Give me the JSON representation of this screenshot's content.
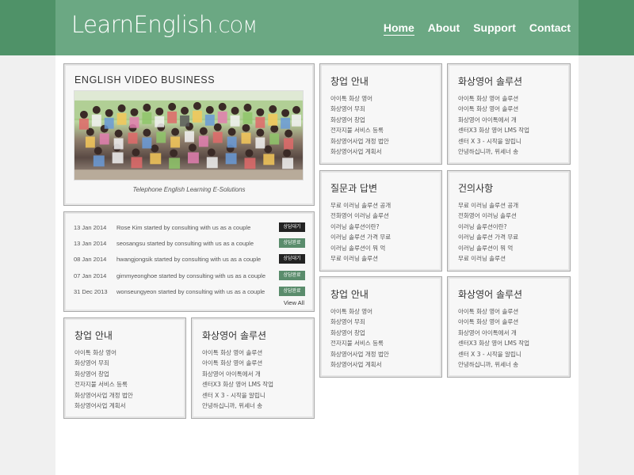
{
  "header": {
    "logo_main": "LearnEnglish",
    "logo_tld": ".COM",
    "nav": [
      "Home",
      "About",
      "Support",
      "Contact"
    ]
  },
  "feature": {
    "title": "ENGLISH VIDEO BUSINESS",
    "caption": "Telephone English Learning E-Solutions"
  },
  "activity": {
    "rows": [
      {
        "date": "13 Jan 2014",
        "text": "Rose Kim started by consulting with us as a couple",
        "badge": "상담대기"
      },
      {
        "date": "13 Jan 2014",
        "text": "seosangsu started by consulting with us as a couple",
        "badge": "상담완료"
      },
      {
        "date": "08 Jan 2014",
        "text": "hwangjongsik started by consulting with us as a couple",
        "badge": "상담대기"
      },
      {
        "date": "07 Jan 2014",
        "text": "gimmyeonghoe started by consulting with us as a couple",
        "badge": "상담완료"
      },
      {
        "date": "31 Dec 2013",
        "text": "wonseungyeon started by consulting with us as a couple",
        "badge": "상담완료"
      }
    ],
    "view_all": "View All"
  },
  "boxes": {
    "startup": {
      "title": "창업 안내",
      "items": [
        "아이톡 화상 영어",
        "화상영어 무죄",
        "화상영어 창업",
        "전자지불 서비스 등록",
        "화상영어사업 개정 법안",
        "화상영어사업 계획서"
      ]
    },
    "solution": {
      "title": "화상영어 솔루션",
      "items": [
        "아이톡 화상 영어 솔루션",
        "아이톡 화상 영어 솔루션",
        "화상영어 아이톡에서 개",
        "센터X3 화상 영어 LMS 작업",
        "센터 X 3 - 시작을 알립니",
        "안녕하십니까, 위세너 송"
      ]
    },
    "qa": {
      "title": "질문과 답변",
      "items": [
        "무료 이러닝 솔루션 공개",
        "전화영어 이러닝 솔루션",
        "이러닝 솔루션이란?",
        "이러닝 솔루션 가격 무료",
        "이러닝 솔루션이 뭐 억",
        "무료 이러닝 솔루션"
      ]
    },
    "suggest": {
      "title": "건의사항",
      "items": [
        "무료 이러닝 솔루션 공개",
        "전화영어 이러닝 솔루션",
        "이러닝 솔루션이란?",
        "이러닝 솔루션 가격 무료",
        "이러닝 솔루션이 뭐 억",
        "무료 이러닝 솔루션"
      ]
    }
  },
  "colors": {
    "header_outer": "#4f9268",
    "header_inner": "#6ba883",
    "badge_dark": "#222222",
    "badge_green": "#5a8c6c"
  }
}
